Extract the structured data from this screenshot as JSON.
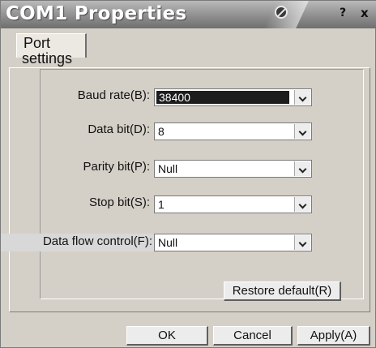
{
  "window": {
    "title": "COM1 Properties"
  },
  "titlebar": {
    "icons": [
      "settings-icon",
      "help-icon",
      "close-icon"
    ],
    "help_glyph": "?",
    "close_glyph": "x"
  },
  "tab": {
    "line1": "Port",
    "line2": "settings"
  },
  "fields": {
    "baud_rate": {
      "label": "Baud rate(B):",
      "value": "38400"
    },
    "data_bit": {
      "label": "Data bit(D):",
      "value": "8"
    },
    "parity_bit": {
      "label": "Parity bit(P):",
      "value": "Null"
    },
    "stop_bit": {
      "label": "Stop bit(S):",
      "value": "1"
    },
    "flow_control": {
      "label": "Data flow control(F):",
      "value": "Null"
    }
  },
  "buttons": {
    "restore": "Restore default(R)",
    "ok": "OK",
    "cancel": "Cancel",
    "apply": "Apply(A)"
  }
}
